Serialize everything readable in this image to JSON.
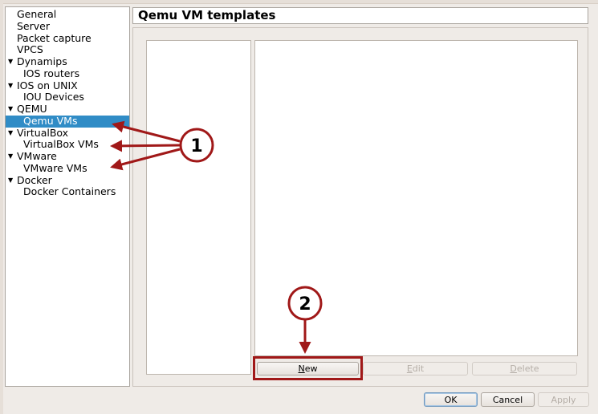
{
  "sidebar": {
    "items": [
      {
        "label": "General",
        "level": 0,
        "expandable": false
      },
      {
        "label": "Server",
        "level": 0,
        "expandable": false
      },
      {
        "label": "Packet capture",
        "level": 0,
        "expandable": false
      },
      {
        "label": "VPCS",
        "level": 0,
        "expandable": false
      },
      {
        "label": "Dynamips",
        "level": 0,
        "expandable": true
      },
      {
        "label": "IOS routers",
        "level": 1,
        "expandable": false
      },
      {
        "label": "IOS on UNIX",
        "level": 0,
        "expandable": true
      },
      {
        "label": "IOU Devices",
        "level": 1,
        "expandable": false
      },
      {
        "label": "QEMU",
        "level": 0,
        "expandable": true
      },
      {
        "label": "Qemu VMs",
        "level": 1,
        "expandable": false,
        "selected": true
      },
      {
        "label": "VirtualBox",
        "level": 0,
        "expandable": true
      },
      {
        "label": "VirtualBox VMs",
        "level": 1,
        "expandable": false
      },
      {
        "label": "VMware",
        "level": 0,
        "expandable": true
      },
      {
        "label": "VMware VMs",
        "level": 1,
        "expandable": false
      },
      {
        "label": "Docker",
        "level": 0,
        "expandable": true
      },
      {
        "label": "Docker Containers",
        "level": 1,
        "expandable": false
      }
    ]
  },
  "main": {
    "title": "Qemu VM templates",
    "buttons": {
      "new": {
        "label": "New",
        "mnemonic": "N",
        "rest": "ew"
      },
      "edit": {
        "label": "Edit",
        "mnemonic": "E",
        "rest": "dit"
      },
      "delete": {
        "label": "Delete",
        "mnemonic": "D",
        "rest": "elete"
      }
    }
  },
  "footer": {
    "ok_label": "OK",
    "cancel_label": "Cancel",
    "apply_label": "Apply"
  },
  "annotations": {
    "callout_1": "1",
    "callout_2": "2",
    "color": "#a01818"
  }
}
